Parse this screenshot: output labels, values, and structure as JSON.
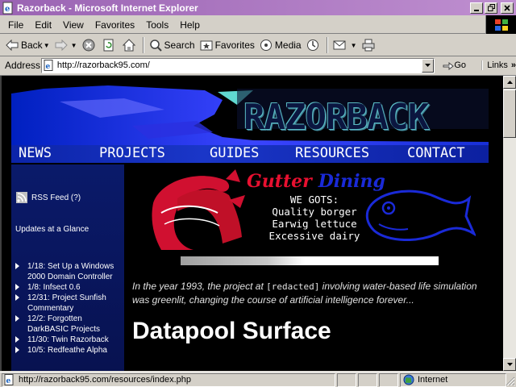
{
  "window": {
    "title": "Razorback - Microsoft Internet Explorer"
  },
  "menu": [
    "File",
    "Edit",
    "View",
    "Favorites",
    "Tools",
    "Help"
  ],
  "toolbar": {
    "back_label": "Back",
    "search_label": "Search",
    "favorites_label": "Favorites",
    "media_label": "Media"
  },
  "address": {
    "label": "Address",
    "url": "http://razorback95.com/",
    "go_label": "Go",
    "links_label": "Links"
  },
  "site": {
    "logo_text": "RAZORBACK",
    "nav": [
      "NEWS",
      "PROJECTS",
      "GUIDES",
      "RESOURCES",
      "CONTACT"
    ],
    "rss_label": "RSS Feed (?)",
    "updates_title": "Updates at a Glance",
    "updates": [
      "1/18: Set Up a Windows 2000 Domain Controller",
      "1/8: Infsect 0.6",
      "12/31: Project Sunfish Commentary",
      "12/2: Forgotten DarkBASIC Projects",
      "11/30: Twin Razorback",
      "10/5: Redfeathe Alpha"
    ],
    "gutter_title_1": "Gutter",
    "gutter_title_2": "Dining",
    "gots_heading": "WE GOTS:",
    "gots": [
      "Quality borger",
      "Earwig lettuce",
      "Excessive dairy"
    ],
    "load_progress": 0.48,
    "intro_before": "In the year 1993, the project at ",
    "intro_code": "[redacted]",
    "intro_after": " involving water-based life simulation was greenlit, changing the course of artificial intelligence forever...",
    "section_heading": "Datapool Surface"
  },
  "status": {
    "text": "http://razorback95.com/resources/index.php",
    "zone": "Internet"
  },
  "colors": {
    "titlebar": "#9a63b3",
    "page_bg": "#000000",
    "nav_bar": "#1a36c8",
    "logo_teal": "#58b8c0",
    "accent_red": "#e81030",
    "accent_blue": "#1a2ad8"
  }
}
